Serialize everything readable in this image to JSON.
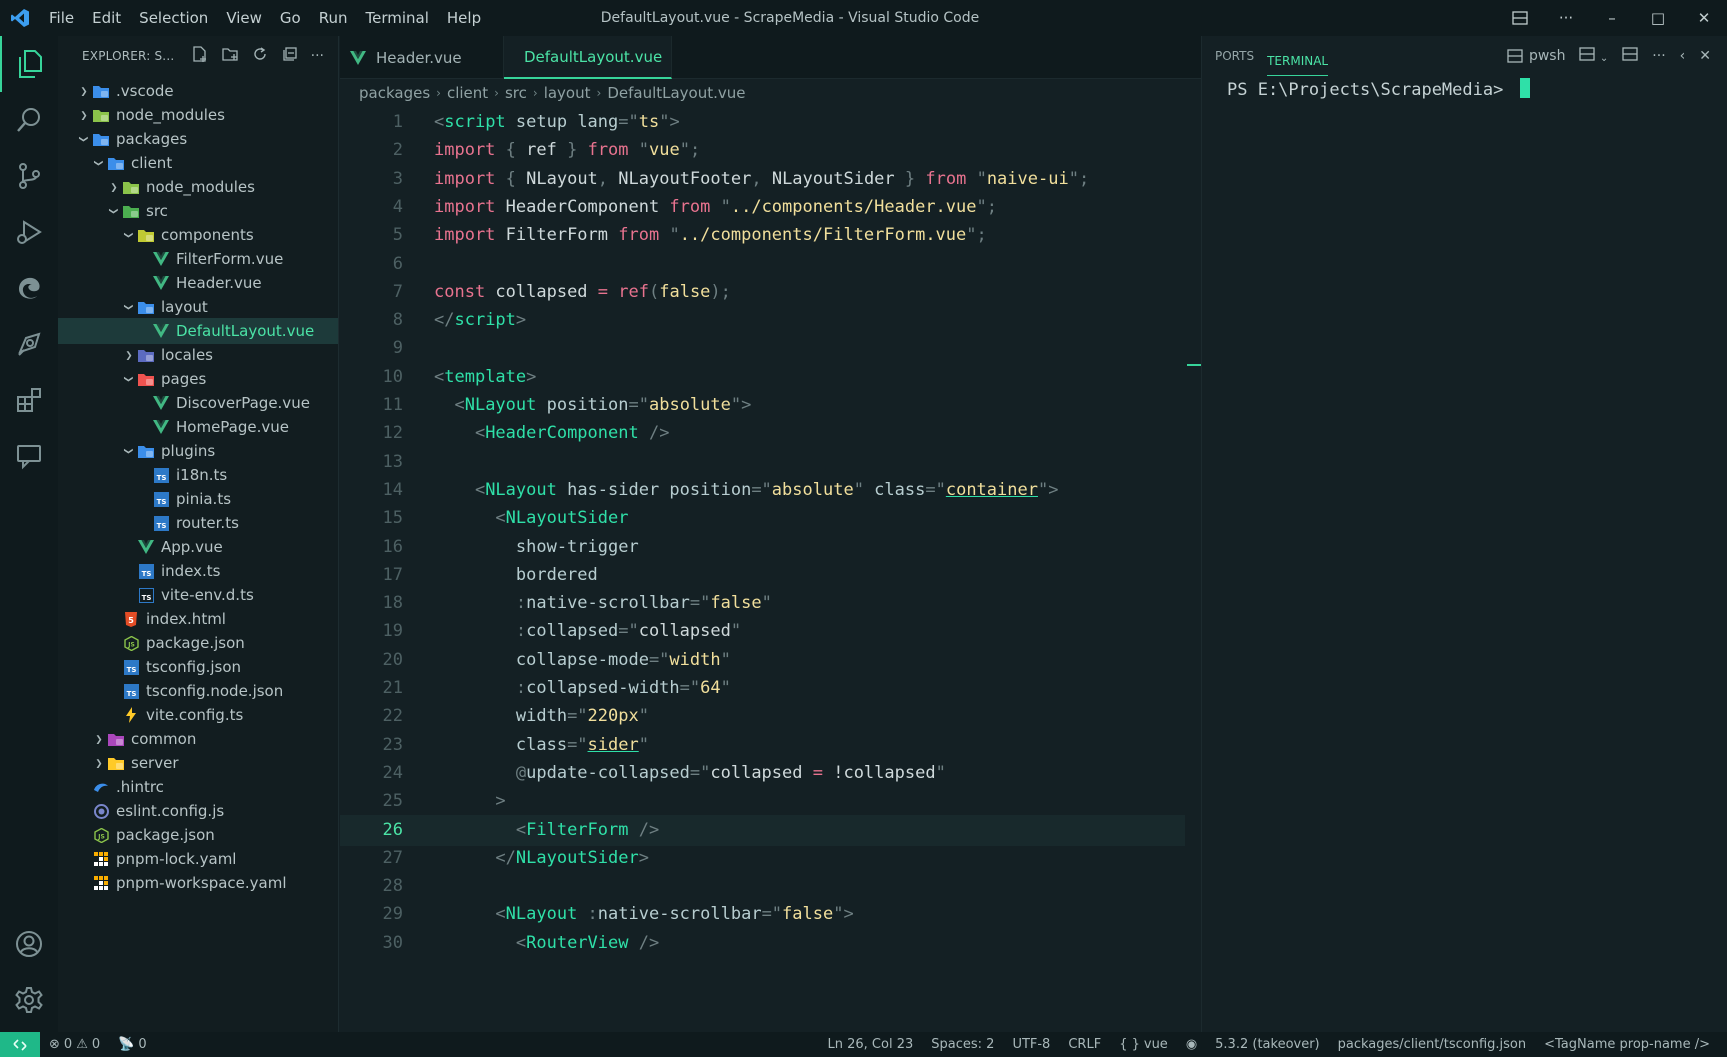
{
  "titlebar": {
    "menu": [
      "File",
      "Edit",
      "Selection",
      "View",
      "Go",
      "Run",
      "Terminal",
      "Help"
    ],
    "window_title": "DefaultLayout.vue - ScrapeMedia - Visual Studio Code"
  },
  "sidebar": {
    "title": "EXPLORER: S...",
    "tree": [
      {
        "label": ".vscode",
        "depth": 0,
        "chev": "right",
        "icon": "folder-vscode",
        "color": "#3b8eea"
      },
      {
        "label": "node_modules",
        "depth": 0,
        "chev": "right",
        "icon": "folder-node",
        "color": "#8bc34a"
      },
      {
        "label": "packages",
        "depth": 0,
        "chev": "down",
        "icon": "folder-packages",
        "color": "#3b8eea"
      },
      {
        "label": "client",
        "depth": 1,
        "chev": "down",
        "icon": "folder-client",
        "color": "#3b8eea"
      },
      {
        "label": "node_modules",
        "depth": 2,
        "chev": "right",
        "icon": "folder-node",
        "color": "#8bc34a"
      },
      {
        "label": "src",
        "depth": 2,
        "chev": "down",
        "icon": "folder-src",
        "color": "#4caf50"
      },
      {
        "label": "components",
        "depth": 3,
        "chev": "down",
        "icon": "folder-components",
        "color": "#c0ca33"
      },
      {
        "label": "FilterForm.vue",
        "depth": 4,
        "chev": "",
        "icon": "vue-file",
        "color": "#41b883"
      },
      {
        "label": "Header.vue",
        "depth": 4,
        "chev": "",
        "icon": "vue-file",
        "color": "#41b883"
      },
      {
        "label": "layout",
        "depth": 3,
        "chev": "down",
        "icon": "folder-layout",
        "color": "#3b8eea"
      },
      {
        "label": "DefaultLayout.vue",
        "depth": 4,
        "chev": "",
        "icon": "vue-file",
        "color": "#41b883",
        "selected": true
      },
      {
        "label": "locales",
        "depth": 3,
        "chev": "right",
        "icon": "folder-locales",
        "color": "#5c6bc0"
      },
      {
        "label": "pages",
        "depth": 3,
        "chev": "down",
        "icon": "folder-pages",
        "color": "#ef5350"
      },
      {
        "label": "DiscoverPage.vue",
        "depth": 4,
        "chev": "",
        "icon": "vue-file",
        "color": "#41b883"
      },
      {
        "label": "HomePage.vue",
        "depth": 4,
        "chev": "",
        "icon": "vue-file",
        "color": "#41b883"
      },
      {
        "label": "plugins",
        "depth": 3,
        "chev": "down",
        "icon": "folder-plugins",
        "color": "#3b8eea"
      },
      {
        "label": "i18n.ts",
        "depth": 4,
        "chev": "",
        "icon": "ts-file",
        "color": "#2d79c7"
      },
      {
        "label": "pinia.ts",
        "depth": 4,
        "chev": "",
        "icon": "ts-file",
        "color": "#2d79c7"
      },
      {
        "label": "router.ts",
        "depth": 4,
        "chev": "",
        "icon": "ts-file",
        "color": "#2d79c7"
      },
      {
        "label": "App.vue",
        "depth": 3,
        "chev": "",
        "icon": "vue-file",
        "color": "#41b883"
      },
      {
        "label": "index.ts",
        "depth": 3,
        "chev": "",
        "icon": "ts-file",
        "color": "#2d79c7"
      },
      {
        "label": "vite-env.d.ts",
        "depth": 3,
        "chev": "",
        "icon": "dts-file",
        "color": "#2d79c7"
      },
      {
        "label": "index.html",
        "depth": 2,
        "chev": "",
        "icon": "html-file",
        "color": "#e44d26"
      },
      {
        "label": "package.json",
        "depth": 2,
        "chev": "",
        "icon": "npm-file",
        "color": "#8bc34a"
      },
      {
        "label": "tsconfig.json",
        "depth": 2,
        "chev": "",
        "icon": "tsconfig-file",
        "color": "#2d79c7"
      },
      {
        "label": "tsconfig.node.json",
        "depth": 2,
        "chev": "",
        "icon": "tsconfig-file",
        "color": "#2d79c7"
      },
      {
        "label": "vite.config.ts",
        "depth": 2,
        "chev": "",
        "icon": "vite-file",
        "color": "#ffca28"
      },
      {
        "label": "common",
        "depth": 1,
        "chev": "right",
        "icon": "folder-common",
        "color": "#ab47bc"
      },
      {
        "label": "server",
        "depth": 1,
        "chev": "right",
        "icon": "folder-server",
        "color": "#ffca28"
      },
      {
        "label": ".hintrc",
        "depth": 0,
        "chev": "",
        "icon": "hint-file",
        "color": "#3b8eea"
      },
      {
        "label": "eslint.config.js",
        "depth": 0,
        "chev": "",
        "icon": "eslint-file",
        "color": "#7986cb"
      },
      {
        "label": "package.json",
        "depth": 0,
        "chev": "",
        "icon": "npm-file",
        "color": "#8bc34a"
      },
      {
        "label": "pnpm-lock.yaml",
        "depth": 0,
        "chev": "",
        "icon": "pnpm-file",
        "color": "#f9ad00"
      },
      {
        "label": "pnpm-workspace.yaml",
        "depth": 0,
        "chev": "",
        "icon": "pnpm-file",
        "color": "#f9ad00"
      }
    ]
  },
  "editor": {
    "tabs": [
      {
        "label": "Header.vue",
        "active": false
      },
      {
        "label": "DefaultLayout.vue",
        "active": true
      }
    ],
    "breadcrumb": [
      "packages",
      "client",
      "src",
      "layout",
      "DefaultLayout.vue"
    ],
    "current_line": 26,
    "lines": [
      [
        [
          "t-br",
          "<"
        ],
        [
          "t-tag",
          "script"
        ],
        [
          "t-attr",
          " setup lang"
        ],
        [
          "t-br",
          "=\""
        ],
        [
          "t-str",
          "ts"
        ],
        [
          "t-br",
          "\">"
        ]
      ],
      [
        [
          "t-kw",
          "import"
        ],
        [
          "t-br",
          " { "
        ],
        [
          "t-id",
          "ref"
        ],
        [
          "t-br",
          " } "
        ],
        [
          "t-kw",
          "from"
        ],
        [
          "t-br",
          " \""
        ],
        [
          "t-str",
          "vue"
        ],
        [
          "t-br",
          "\";"
        ]
      ],
      [
        [
          "t-kw",
          "import"
        ],
        [
          "t-br",
          " { "
        ],
        [
          "t-id",
          "NLayout"
        ],
        [
          "t-br",
          ", "
        ],
        [
          "t-id",
          "NLayoutFooter"
        ],
        [
          "t-br",
          ", "
        ],
        [
          "t-id",
          "NLayoutSider"
        ],
        [
          "t-br",
          " } "
        ],
        [
          "t-kw",
          "from"
        ],
        [
          "t-br",
          " \""
        ],
        [
          "t-str",
          "naive-ui"
        ],
        [
          "t-br",
          "\";"
        ]
      ],
      [
        [
          "t-kw",
          "import"
        ],
        [
          "t-id",
          " HeaderComponent "
        ],
        [
          "t-kw",
          "from"
        ],
        [
          "t-br",
          " \""
        ],
        [
          "t-str",
          "../components/Header.vue"
        ],
        [
          "t-br",
          "\";"
        ]
      ],
      [
        [
          "t-kw",
          "import"
        ],
        [
          "t-id",
          " FilterForm "
        ],
        [
          "t-kw",
          "from"
        ],
        [
          "t-br",
          " \""
        ],
        [
          "t-str",
          "../components/FilterForm.vue"
        ],
        [
          "t-br",
          "\";"
        ]
      ],
      [],
      [
        [
          "t-kw",
          "const"
        ],
        [
          "t-id",
          " collapsed "
        ],
        [
          "t-kw",
          "="
        ],
        [
          "t-fn",
          " ref"
        ],
        [
          "t-br",
          "("
        ],
        [
          "t-str",
          "false"
        ],
        [
          "t-br",
          ");"
        ]
      ],
      [
        [
          "t-br",
          "</"
        ],
        [
          "t-tag",
          "script"
        ],
        [
          "t-br",
          ">"
        ]
      ],
      [],
      [
        [
          "t-br",
          "<"
        ],
        [
          "t-tag",
          "template"
        ],
        [
          "t-br",
          ">"
        ]
      ],
      [
        [
          "t-br",
          "  <"
        ],
        [
          "t-comp",
          "NLayout"
        ],
        [
          "t-attr",
          " position"
        ],
        [
          "t-br",
          "=\""
        ],
        [
          "t-str",
          "absolute"
        ],
        [
          "t-br",
          "\">"
        ]
      ],
      [
        [
          "t-br",
          "    <"
        ],
        [
          "t-comp",
          "HeaderComponent"
        ],
        [
          "t-br",
          " />"
        ]
      ],
      [],
      [
        [
          "t-br",
          "    <"
        ],
        [
          "t-comp",
          "NLayout"
        ],
        [
          "t-attr",
          " has-sider position"
        ],
        [
          "t-br",
          "=\""
        ],
        [
          "t-str",
          "absolute"
        ],
        [
          "t-br",
          "\" "
        ],
        [
          "t-attr",
          "class"
        ],
        [
          "t-br",
          "=\""
        ],
        [
          "t-str u",
          "container"
        ],
        [
          "t-br",
          "\">"
        ]
      ],
      [
        [
          "t-br",
          "      <"
        ],
        [
          "t-comp",
          "NLayoutSider"
        ]
      ],
      [
        [
          "t-attr",
          "        show-trigger"
        ]
      ],
      [
        [
          "t-attr",
          "        bordered"
        ]
      ],
      [
        [
          "t-br",
          "        :"
        ],
        [
          "t-attr",
          "native-scrollbar"
        ],
        [
          "t-br",
          "=\""
        ],
        [
          "t-str",
          "false"
        ],
        [
          "t-br",
          "\""
        ]
      ],
      [
        [
          "t-br",
          "        :"
        ],
        [
          "t-attr",
          "collapsed"
        ],
        [
          "t-br",
          "=\""
        ],
        [
          "t-id",
          "collapsed"
        ],
        [
          "t-br",
          "\""
        ]
      ],
      [
        [
          "t-attr",
          "        collapse-mode"
        ],
        [
          "t-br",
          "=\""
        ],
        [
          "t-str",
          "width"
        ],
        [
          "t-br",
          "\""
        ]
      ],
      [
        [
          "t-br",
          "        :"
        ],
        [
          "t-attr",
          "collapsed-width"
        ],
        [
          "t-br",
          "=\""
        ],
        [
          "t-str",
          "64"
        ],
        [
          "t-br",
          "\""
        ]
      ],
      [
        [
          "t-attr",
          "        width"
        ],
        [
          "t-br",
          "=\""
        ],
        [
          "t-str",
          "220px"
        ],
        [
          "t-br",
          "\""
        ]
      ],
      [
        [
          "t-attr",
          "        class"
        ],
        [
          "t-br",
          "=\""
        ],
        [
          "t-str u",
          "sider"
        ],
        [
          "t-br",
          "\""
        ]
      ],
      [
        [
          "t-br",
          "        @"
        ],
        [
          "t-attr",
          "update-collapsed"
        ],
        [
          "t-br",
          "=\""
        ],
        [
          "t-id",
          "collapsed "
        ],
        [
          "t-kw",
          "="
        ],
        [
          "t-id",
          " !collapsed"
        ],
        [
          "t-br",
          "\""
        ]
      ],
      [
        [
          "t-br",
          "      >"
        ]
      ],
      [
        [
          "t-br",
          "        <"
        ],
        [
          "t-comp",
          "FilterForm"
        ],
        [
          "t-br",
          " />"
        ]
      ],
      [
        [
          "t-br",
          "      </"
        ],
        [
          "t-comp",
          "NLayoutSider"
        ],
        [
          "t-br",
          ">"
        ]
      ],
      [],
      [
        [
          "t-br",
          "      <"
        ],
        [
          "t-comp",
          "NLayout"
        ],
        [
          "t-br",
          " :"
        ],
        [
          "t-attr",
          "native-scrollbar"
        ],
        [
          "t-br",
          "=\""
        ],
        [
          "t-str",
          "false"
        ],
        [
          "t-br",
          "\">"
        ]
      ],
      [
        [
          "t-br",
          "        <"
        ],
        [
          "t-comp",
          "RouterView"
        ],
        [
          "t-br",
          " />"
        ]
      ]
    ]
  },
  "panel": {
    "tabs": [
      "PORTS",
      "TERMINAL"
    ],
    "active_tab": "TERMINAL",
    "shell": "pwsh",
    "prompt": "PS E:\\Projects\\ScrapeMedia> "
  },
  "statusbar": {
    "errors": "0",
    "warnings": "0",
    "ports": "0",
    "position": "Ln 26, Col 23",
    "spaces": "Spaces: 2",
    "encoding": "UTF-8",
    "eol": "CRLF",
    "language": "vue",
    "ts_version": "5.3.2 (takeover)",
    "tsconfig": "packages/client/tsconfig.json",
    "tagname": "<TagName prop-name />"
  },
  "colors": {
    "accent": "#37d49a",
    "remote": "#1fb888"
  }
}
